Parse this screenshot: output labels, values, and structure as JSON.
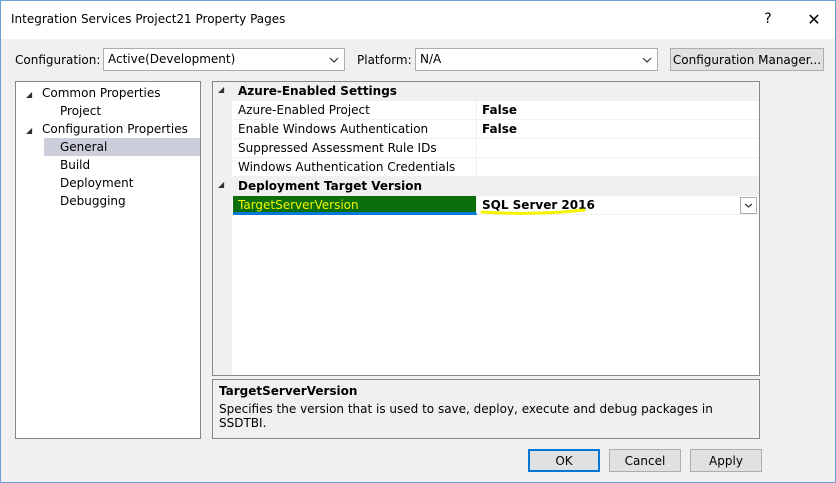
{
  "window": {
    "title": "Integration Services Project21 Property Pages",
    "help_label": "?",
    "close_label": "✕"
  },
  "toolbar": {
    "configuration_label": "Configuration:",
    "configuration_value": "Active(Development)",
    "platform_label": "Platform:",
    "platform_value": "N/A",
    "config_manager_label": "Configuration Manager..."
  },
  "tree": {
    "items": [
      {
        "label": "Common Properties",
        "expanded": true
      },
      {
        "label": "Project"
      },
      {
        "label": "Configuration Properties",
        "expanded": true
      },
      {
        "label": "General",
        "selected": true
      },
      {
        "label": "Build"
      },
      {
        "label": "Deployment"
      },
      {
        "label": "Debugging"
      }
    ]
  },
  "grid": {
    "categories": [
      {
        "name": "Azure-Enabled Settings",
        "properties": [
          {
            "name": "Azure-Enabled Project",
            "value": "False"
          },
          {
            "name": "Enable Windows Authentication",
            "value": "False"
          },
          {
            "name": "Suppressed Assessment Rule IDs",
            "value": ""
          },
          {
            "name": "Windows Authentication Credentials",
            "value": ""
          }
        ]
      },
      {
        "name": "Deployment Target Version",
        "properties": [
          {
            "name": "TargetServerVersion",
            "value": "SQL Server 2016",
            "selected": true
          }
        ]
      }
    ]
  },
  "description": {
    "title": "TargetServerVersion",
    "text": "Specifies the version that is used to save, deploy, execute and debug packages in SSDTBI."
  },
  "buttons": {
    "ok": "OK",
    "cancel": "Cancel",
    "apply": "Apply"
  },
  "colors": {
    "highlight_green": "#0a6e0a",
    "highlight_yellow": "#f4f400",
    "accent_blue": "#0078d7"
  }
}
